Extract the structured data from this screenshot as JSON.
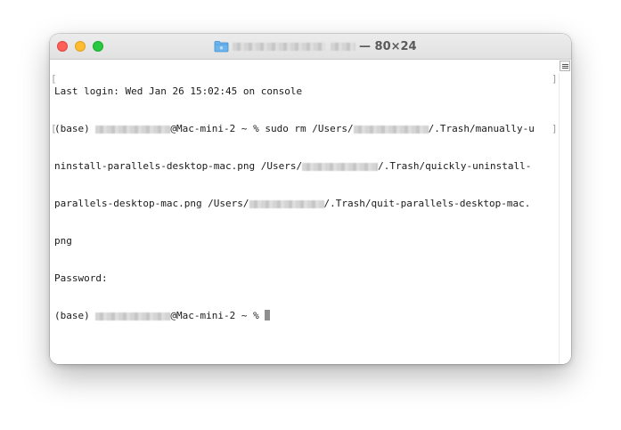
{
  "window": {
    "title_suffix": "— 80×24",
    "icon": "folder-icon"
  },
  "terminal": {
    "lines": {
      "l0": "Last login: Wed Jan 26 15:02:45 on console",
      "l1a": "(base) ",
      "l1b": "@Mac-mini-2 ~ % sudo rm /Users/",
      "l1c": "/.Trash/manually-u",
      "l2a": "ninstall-parallels-desktop-mac.png /Users/",
      "l2b": "/.Trash/quickly-uninstall-",
      "l3a": "parallels-desktop-mac.png /Users/",
      "l3b": "/.Trash/quit-parallels-desktop-mac.",
      "l4": "png",
      "l5": "Password:",
      "l6a": "(base) ",
      "l6b": "@Mac-mini-2 ~ % "
    }
  },
  "marks": {
    "open": "[",
    "close": "]"
  },
  "colors": {
    "close": "#fe5f57",
    "minimize": "#febc2e",
    "zoom": "#28c840",
    "cursor": "#8e8e8e"
  }
}
